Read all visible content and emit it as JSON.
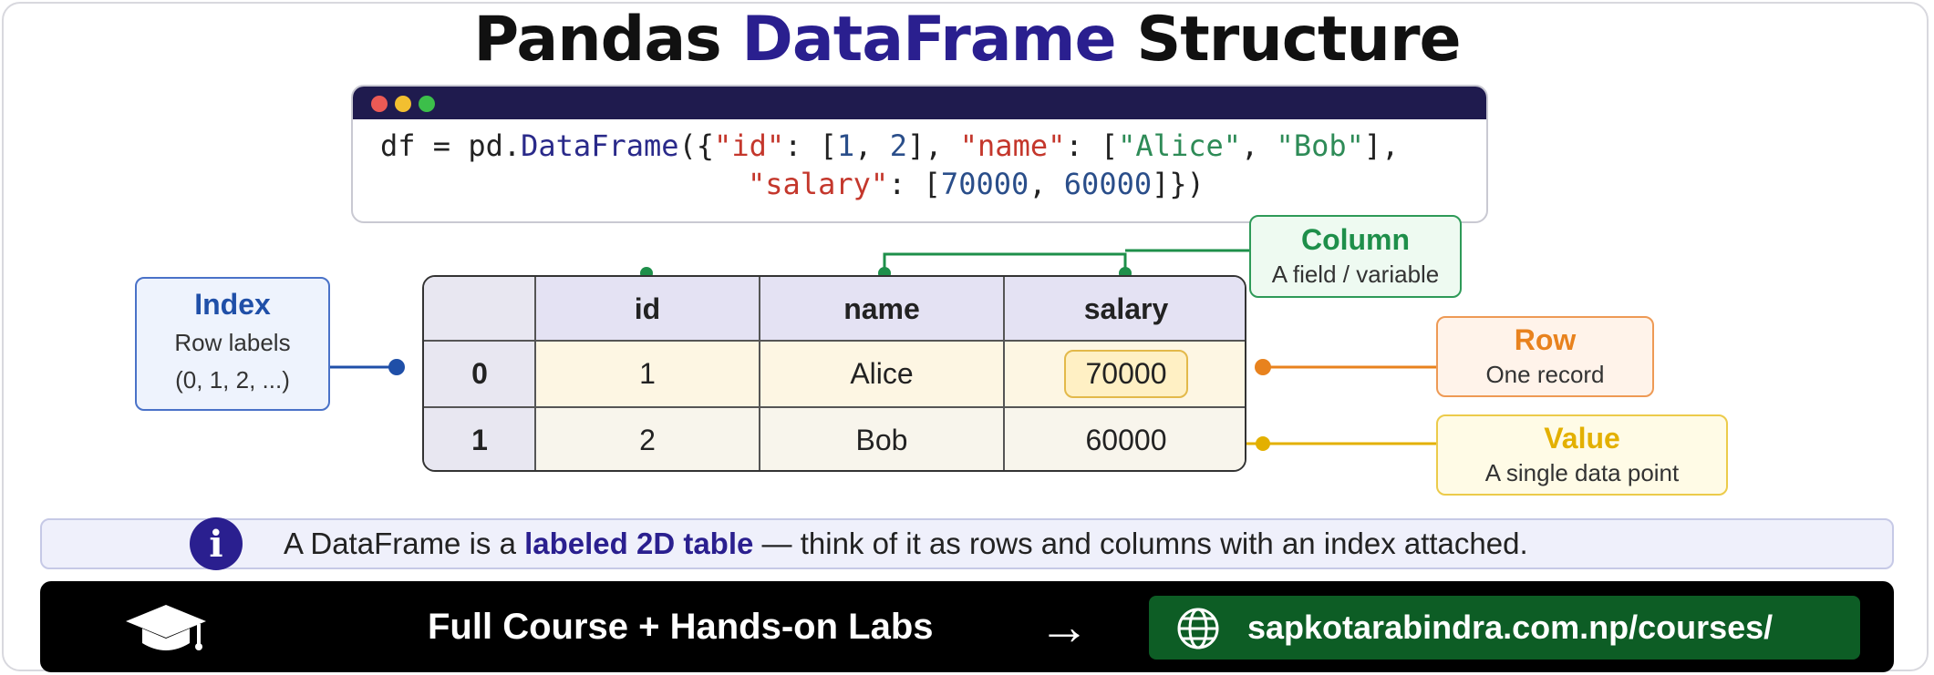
{
  "title": {
    "part1": "Pandas ",
    "highlight": "DataFrame",
    "part2": " Structure"
  },
  "code": {
    "line1": {
      "prefix": "df = pd.",
      "fn": "DataFrame",
      "open": "({",
      "k1": "\"id\"",
      "p1": ": [",
      "n1": "1",
      "c1": ", ",
      "n2": "2",
      "p2": "], ",
      "k2": "\"name\"",
      "p3": ": [",
      "s1": "\"Alice\"",
      "c2": ", ",
      "s2": "\"Bob\"",
      "p4": "],"
    },
    "line2": {
      "k3": "\"salary\"",
      "p1": ": [",
      "n1": "70000",
      "c1": ", ",
      "n2": "60000",
      "p2": "]})"
    }
  },
  "table": {
    "columns": [
      "id",
      "name",
      "salary"
    ],
    "rows": [
      {
        "index": "0",
        "id": "1",
        "name": "Alice",
        "salary": "70000"
      },
      {
        "index": "1",
        "id": "2",
        "name": "Bob",
        "salary": "60000"
      }
    ]
  },
  "callouts": {
    "index": {
      "title": "Index",
      "line1": "Row labels",
      "line2": "(0, 1, 2, ...)"
    },
    "column": {
      "title": "Column",
      "subtitle": "A field / variable"
    },
    "row": {
      "title": "Row",
      "subtitle": "One record"
    },
    "value": {
      "title": "Value",
      "subtitle": "A single data point"
    }
  },
  "info": {
    "pre": "A DataFrame is a ",
    "bold": "labeled 2D table",
    "post": " — think of it as rows and columns with an index attached.",
    "icon": "info-icon"
  },
  "cta": {
    "label": "Full Course + Hands-on Labs",
    "arrow": "→",
    "link": "sapkotarabindra.com.np/courses/",
    "icon_left": "graduation-cap-icon",
    "icon_link": "globe-icon"
  },
  "colors": {
    "accent": "#2a1f8f",
    "green": "#1e8f4a",
    "orange": "#e8821e",
    "gold": "#e3b000",
    "blue": "#1f4fa8"
  }
}
